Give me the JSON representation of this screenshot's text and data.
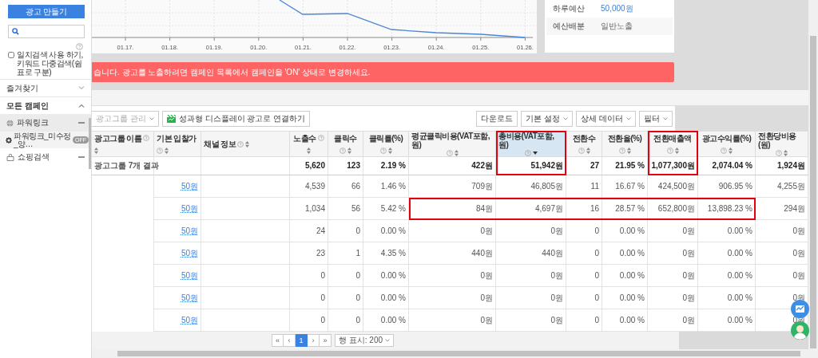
{
  "sidebar": {
    "create_button": "광고 만들기",
    "exact_match": {
      "label": "일치검색 사용 하기, 키워드 다중검색(쉼표로 구분)",
      "checked": false
    },
    "favorites": {
      "label": "즐겨찾기",
      "expanded": false
    },
    "campaigns": {
      "label": "모든 캠페인",
      "expanded": true,
      "items": [
        {
          "kind": "powerlink",
          "label": "파워링크",
          "expanded": true,
          "selected": true,
          "children": [
            {
              "label": "파워링크_미수정_양…",
              "status": "OFF",
              "selected": true
            }
          ]
        },
        {
          "kind": "shopping",
          "label": "쇼핑검색",
          "expanded": true,
          "selected": false
        }
      ]
    }
  },
  "chart": {
    "x_labels": [
      "01.17.",
      "01.18.",
      "01.19.",
      "01.20.",
      "01.21.",
      "01.22.",
      "01.23.",
      "01.24.",
      "01.25.",
      "01.26."
    ]
  },
  "budget": [
    {
      "label": "하루예산",
      "value": "50,000원",
      "kind": "link"
    },
    {
      "label": "예산배분",
      "value": "일반노출",
      "kind": "text"
    }
  ],
  "alert": {
    "text": "습니다. 광고를 노출하려면 캠페인 목록에서 캠페인을 'ON' 상태로 변경하세요."
  },
  "toolbar": {
    "left": [
      {
        "label": "광고그룹 관리",
        "kind": "dropdown",
        "disabled": true
      },
      {
        "label": "성과형 디스플레이 광고로 연결하기",
        "kind": "icon",
        "disabled": false
      }
    ],
    "right": [
      {
        "label": "다운로드",
        "kind": "plain"
      },
      {
        "label": "기본 설정",
        "kind": "dropdown"
      },
      {
        "label": "상세 데이터",
        "kind": "dropdown"
      },
      {
        "label": "필터",
        "kind": "dropdown"
      }
    ]
  },
  "table": {
    "columns": [
      {
        "label": "광고그룹 이름",
        "sorted": false,
        "highlighted": false,
        "in_row_highlight": false
      },
      {
        "label": "기본 입찰가",
        "sorted": false,
        "highlighted": false,
        "in_row_highlight": false
      },
      {
        "label": "채널 정보",
        "sorted": false,
        "highlighted": false,
        "in_row_highlight": false
      },
      {
        "label": "노출수",
        "sorted": false,
        "highlighted": false,
        "in_row_highlight": false
      },
      {
        "label": "클릭수",
        "sorted": false,
        "highlighted": false,
        "in_row_highlight": false
      },
      {
        "label": "클릭률(%)",
        "sorted": false,
        "highlighted": false,
        "in_row_highlight": false
      },
      {
        "label": "평균클릭비용(VAT포함,원)",
        "sorted": false,
        "highlighted": false,
        "in_row_highlight": true
      },
      {
        "label": "총비용(VAT포함,원)",
        "sorted": true,
        "highlighted": true,
        "in_row_highlight": true
      },
      {
        "label": "전환수",
        "sorted": false,
        "highlighted": false,
        "in_row_highlight": true
      },
      {
        "label": "전환율(%)",
        "sorted": false,
        "highlighted": false,
        "in_row_highlight": true
      },
      {
        "label": "전환매출액",
        "sorted": false,
        "highlighted": true,
        "in_row_highlight": true
      },
      {
        "label": "광고수익률(%)",
        "sorted": false,
        "highlighted": false,
        "in_row_highlight": true
      },
      {
        "label": "전환당비용(원)",
        "sorted": false,
        "highlighted": false,
        "in_row_highlight": false
      }
    ],
    "summary": {
      "label": "광고그룹 7개 결과",
      "values": [
        "5,620",
        "123",
        "2.19 %",
        "422원",
        "51,942원",
        "27",
        "21.95 %",
        "1,077,300원",
        "2,074.04 %",
        "1,924원"
      ]
    },
    "rows": [
      {
        "bid": "50원",
        "highlighted": false,
        "values": [
          "4,539",
          "66",
          "1.46 %",
          "709원",
          "46,805원",
          "11",
          "16.67 %",
          "424,500원",
          "906.95 %",
          "4,255원"
        ]
      },
      {
        "bid": "50원",
        "highlighted": true,
        "values": [
          "1,034",
          "56",
          "5.42 %",
          "84원",
          "4,697원",
          "16",
          "28.57 %",
          "652,800원",
          "13,898.23 %",
          "294원"
        ]
      },
      {
        "bid": "50원",
        "highlighted": false,
        "values": [
          "24",
          "0",
          "0.00 %",
          "0원",
          "0원",
          "0",
          "0.00 %",
          "0원",
          "0.00 %",
          "0원"
        ]
      },
      {
        "bid": "50원",
        "highlighted": false,
        "values": [
          "23",
          "1",
          "4.35 %",
          "440원",
          "440원",
          "0",
          "0.00 %",
          "0원",
          "0.00 %",
          "0원"
        ]
      },
      {
        "bid": "50원",
        "highlighted": false,
        "values": [
          "0",
          "0",
          "0.00 %",
          "0원",
          "0원",
          "0",
          "0.00 %",
          "0원",
          "0.00 %",
          "0원"
        ]
      },
      {
        "bid": "50원",
        "highlighted": false,
        "values": [
          "0",
          "0",
          "0.00 %",
          "0원",
          "0원",
          "0",
          "0.00 %",
          "0원",
          "0.00 %",
          "0원"
        ]
      },
      {
        "bid": "50원",
        "highlighted": false,
        "values": [
          "0",
          "0",
          "0.00 %",
          "0원",
          "0원",
          "0",
          "0.00 %",
          "0원",
          "0.00 %",
          "0원"
        ]
      }
    ]
  },
  "pagination": {
    "prev": [
      "«",
      "‹"
    ],
    "pages": [
      {
        "label": "1",
        "selected": true
      }
    ],
    "next": [
      "›",
      "»"
    ],
    "rows_per_page": "행 표시: 200"
  }
}
